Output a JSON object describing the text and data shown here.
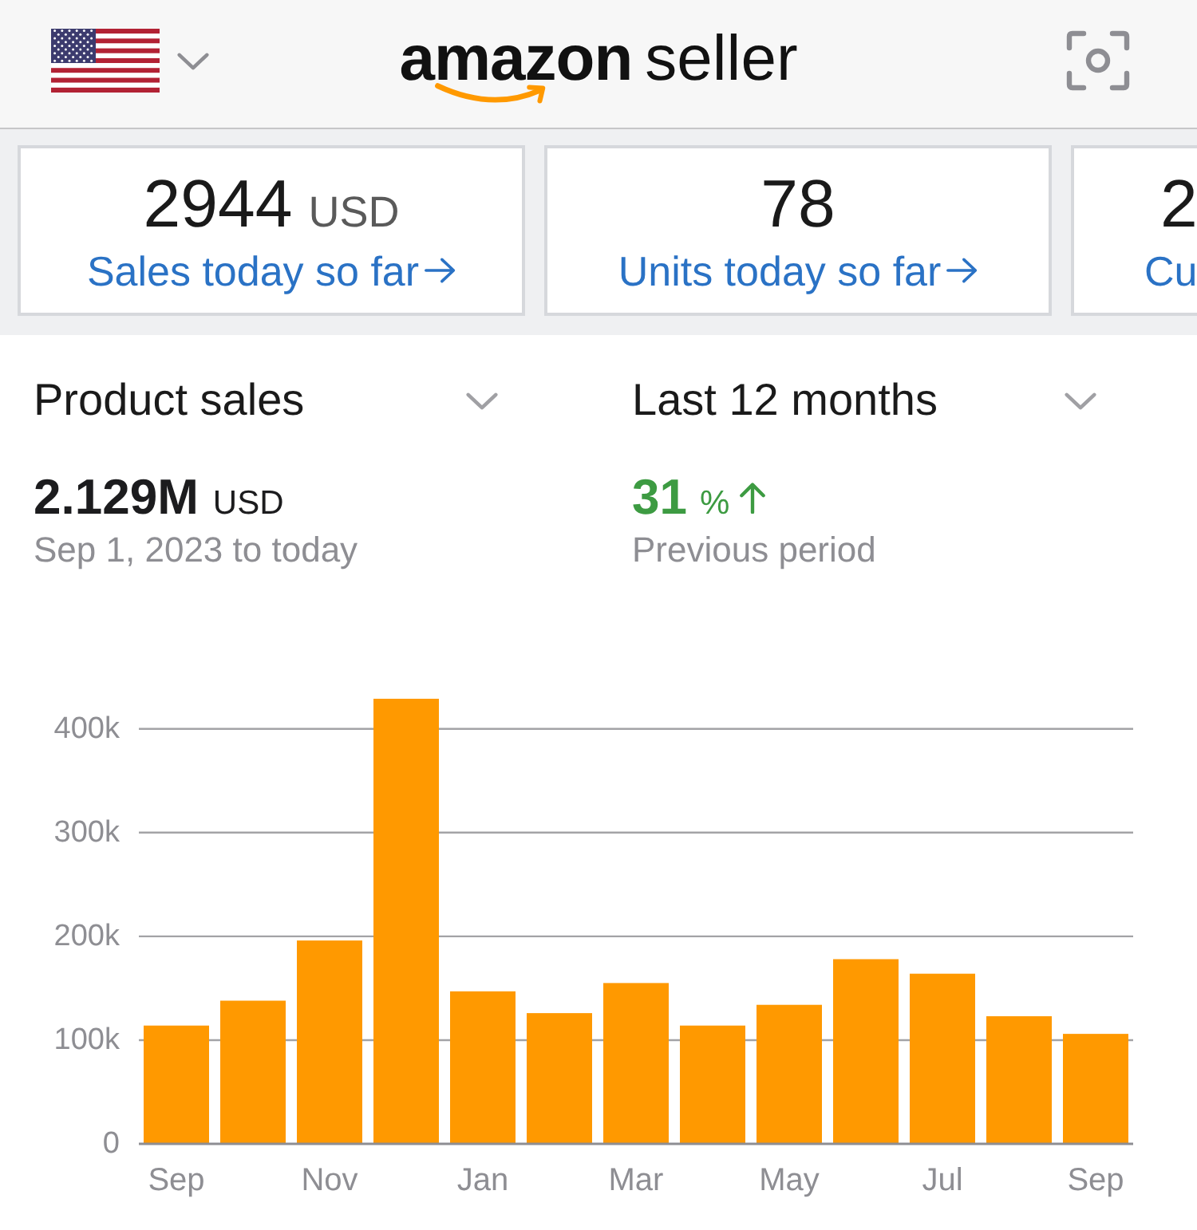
{
  "header": {
    "logo": {
      "brand": "amazon",
      "suffix": "seller"
    }
  },
  "metric_cards": [
    {
      "value": "2944",
      "unit": "USD",
      "link": "Sales today so far",
      "clipped": false
    },
    {
      "value": "78",
      "link": "Units today so far",
      "clipped": false
    },
    {
      "value": "2",
      "link": "Cu",
      "clipped": true
    }
  ],
  "metric_dropdown": {
    "label": "Product sales"
  },
  "period_dropdown": {
    "label": "Last 12 months"
  },
  "total": {
    "value": "2.129M",
    "unit": "USD",
    "range": "Sep 1, 2023 to today"
  },
  "change": {
    "value": "31",
    "unit": "%",
    "increase": true,
    "caption": "Previous period"
  },
  "chart_data": {
    "type": "bar",
    "grid": true,
    "categories": [
      "Sep",
      null,
      "Nov",
      null,
      "Jan",
      null,
      "Mar",
      null,
      "May",
      null,
      "Jul",
      null,
      "Sep"
    ],
    "series": [
      {
        "color": "#ff9900",
        "values": [
          114000,
          138000,
          196000,
          429000,
          147000,
          126000,
          155000,
          114000,
          134000,
          178000,
          164000,
          123000,
          106000
        ]
      }
    ],
    "ylim": [
      0,
      429000
    ],
    "yticks": [
      {
        "value": 0,
        "label": "0"
      },
      {
        "value": 100000,
        "label": "100k"
      },
      {
        "value": 200000,
        "label": "200k"
      },
      {
        "value": 300000,
        "label": "300k"
      },
      {
        "value": 400000,
        "label": "400k"
      }
    ]
  }
}
